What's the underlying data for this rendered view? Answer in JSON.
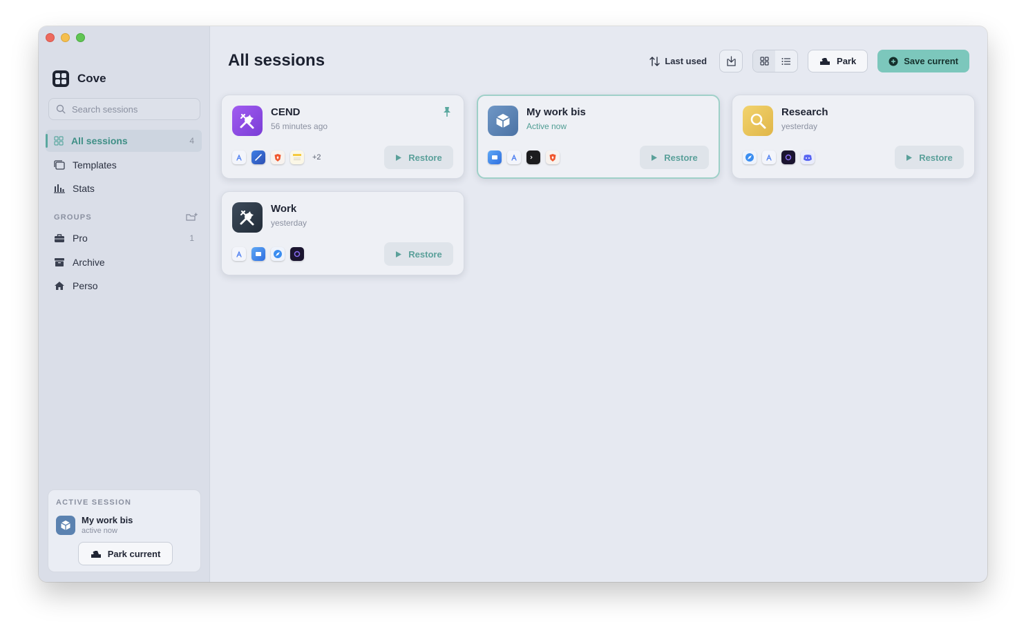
{
  "app": {
    "name": "Cove"
  },
  "sidebar": {
    "search_placeholder": "Search sessions",
    "nav": [
      {
        "label": "All sessions",
        "count": "4",
        "icon": "grid-icon"
      },
      {
        "label": "Templates",
        "icon": "templates-icon"
      },
      {
        "label": "Stats",
        "icon": "stats-icon"
      }
    ],
    "groups_header": "GROUPS",
    "groups": [
      {
        "label": "Pro",
        "count": "1",
        "icon": "briefcase-icon"
      },
      {
        "label": "Archive",
        "icon": "archive-icon"
      },
      {
        "label": "Perso",
        "icon": "house-icon"
      }
    ],
    "active_session": {
      "label": "ACTIVE SESSION",
      "name": "My work bis",
      "status": "active now",
      "park_label": "Park current"
    }
  },
  "main": {
    "title": "All sessions",
    "toolbar": {
      "sort_label": "Last used",
      "park_label": "Park",
      "save_label": "Save current"
    },
    "cards": [
      {
        "title": "CEND",
        "subtitle": "56 minutes ago",
        "icon": "tools-icon",
        "icon_color": "#8b4be0",
        "pinned": true,
        "more": "+2",
        "restore": "Restore"
      },
      {
        "title": "My work bis",
        "subtitle": "Active now",
        "icon": "cube-icon",
        "icon_color": "#5b82b0",
        "active": true,
        "restore": "Restore"
      },
      {
        "title": "Research",
        "subtitle": "yesterday",
        "icon": "magnifier-icon",
        "icon_color": "#e9c45a",
        "restore": "Restore"
      },
      {
        "title": "Work",
        "subtitle": "yesterday",
        "icon": "tools-icon",
        "icon_color": "#2f3d4c",
        "restore": "Restore"
      }
    ]
  },
  "colors": {
    "accent": "#5aa89f",
    "save_button": "#7cc7bc",
    "window_bg": "#e6e9f1",
    "sidebar_bg": "#dadee8"
  }
}
